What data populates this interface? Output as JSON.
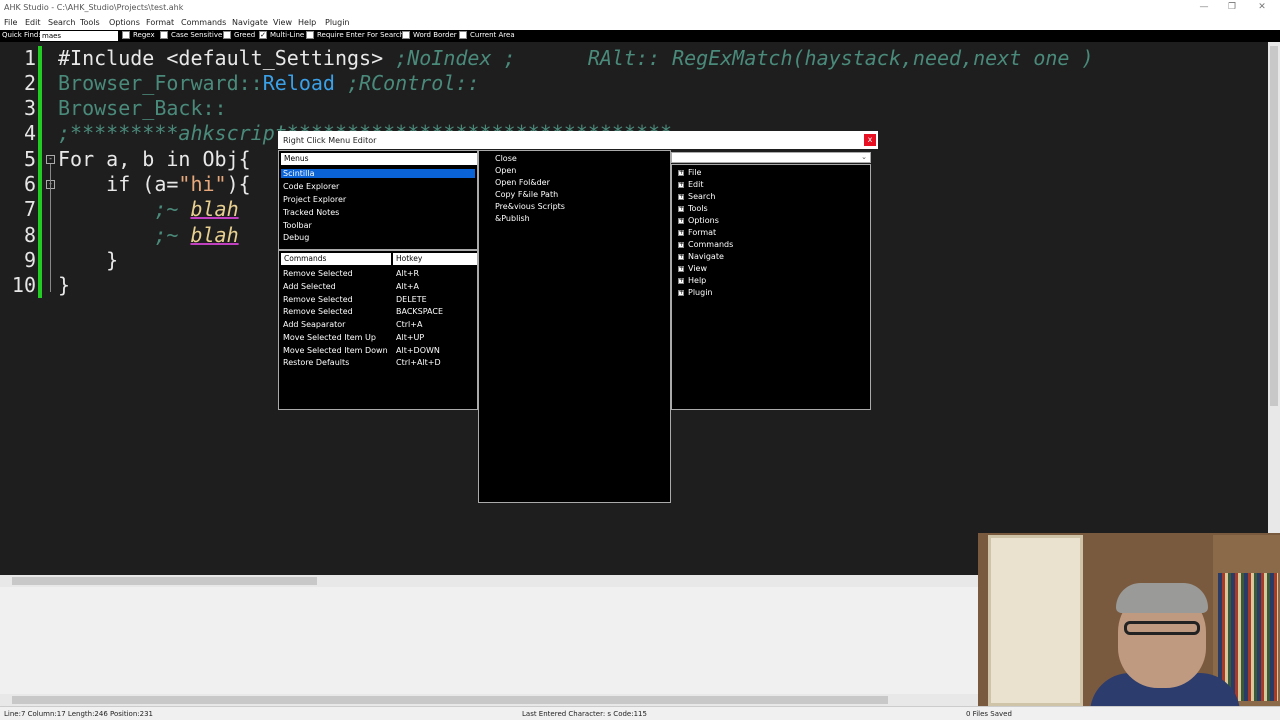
{
  "window": {
    "title": "AHK Studio - C:\\AHK_Studio\\Projects\\test.ahk",
    "minimize": "—",
    "restore": "❐",
    "close": "✕"
  },
  "menubar": [
    "File",
    "Edit",
    "Search",
    "Tools",
    "Options",
    "Format",
    "Commands",
    "Navigate",
    "View",
    "Help",
    "Plugin"
  ],
  "quickfind": {
    "label": "Quick Find:",
    "value": "maes",
    "options": [
      {
        "label": "Regex",
        "checked": false
      },
      {
        "label": "Case Sensitive",
        "checked": false
      },
      {
        "label": "Greed",
        "checked": false
      },
      {
        "label": "Multi-Line",
        "checked": true
      },
      {
        "label": "Require Enter For Search",
        "checked": false
      },
      {
        "label": "Word Border",
        "checked": false
      },
      {
        "label": "Current Area",
        "checked": false
      }
    ]
  },
  "editor": {
    "line_numbers": [
      "1",
      "2",
      "3",
      "4",
      "5",
      "6",
      "7",
      "8",
      "9",
      "10"
    ],
    "lines": {
      "l1a": "#Include <default_Settings> ",
      "l1b": ";NoIndex ;      RAlt:: RegExMatch(haystack,need,next one )",
      "l2a": "Browser_Forward::",
      "l2b": "Reload",
      "l2c": " ;RControl::",
      "l3": "Browser_Back::",
      "l4": ";*********ahkscript********************************",
      "l5": "For a, b in Obj{",
      "l6a": "    if (a=",
      "l6b": "\"hi\"",
      "l6c": "){",
      "l7a": "        ;~ ",
      "l7b": "blah",
      "l8a": "        ;~ ",
      "l8b": "blah",
      "l9": "    }",
      "l10": "}"
    }
  },
  "dialog": {
    "title": "Right Click Menu Editor",
    "close": "x",
    "menus_header": "Menus",
    "menus": [
      "Scintilla",
      "Code Explorer",
      "Project Explorer",
      "Tracked Notes",
      "Toolbar",
      "Debug"
    ],
    "selected_menu": "Scintilla",
    "commands_header": "Commands",
    "hotkey_header": "Hotkey",
    "commands": [
      {
        "name": "Remove Selected",
        "hotkey": "Alt+R"
      },
      {
        "name": "Add Selected",
        "hotkey": "Alt+A"
      },
      {
        "name": "Remove Selected",
        "hotkey": "DELETE"
      },
      {
        "name": "Remove Selected",
        "hotkey": "BACKSPACE"
      },
      {
        "name": "Add Seaparator",
        "hotkey": "Ctrl+A"
      },
      {
        "name": "Move Selected Item Up",
        "hotkey": "Alt+UP"
      },
      {
        "name": "Move Selected Item Down",
        "hotkey": "Alt+DOWN"
      },
      {
        "name": "Restore Defaults",
        "hotkey": "Ctrl+Alt+D"
      }
    ],
    "menu_items": [
      "Close",
      "Open",
      "Open Fol&der",
      "Copy F&ile Path",
      "Pre&vious Scripts",
      "&Publish"
    ],
    "combo_arrow": "⌄",
    "tree": [
      "File",
      "Edit",
      "Search",
      "Tools",
      "Options",
      "Format",
      "Commands",
      "Navigate",
      "View",
      "Help",
      "Plugin"
    ]
  },
  "status": {
    "position": "Line:7 Column:17 Length:246 Position:231",
    "last_char": "Last Entered Character: s Code:115",
    "files_saved": "0 Files Saved"
  },
  "colors": {
    "editor_bg": "#1e1e1e",
    "selection": "#0a64d8",
    "change_bar": "#22cc22",
    "close_red": "#e81123"
  }
}
